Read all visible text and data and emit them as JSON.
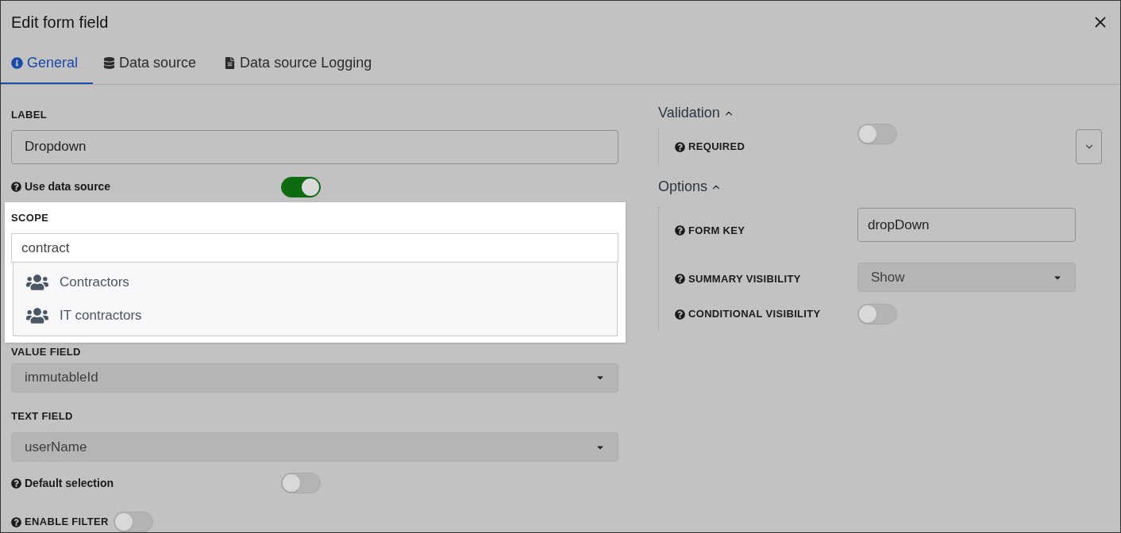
{
  "dialog": {
    "title": "Edit form field"
  },
  "tabs": [
    {
      "label": "General",
      "kind": "info",
      "selected": true
    },
    {
      "label": "Data source",
      "kind": "database",
      "selected": false
    },
    {
      "label": "Data source Logging",
      "kind": "file",
      "selected": false
    }
  ],
  "left": {
    "label_field": {
      "label": "LABEL",
      "value": "Dropdown"
    },
    "use_data_source": {
      "label": "Use data source",
      "on": true
    },
    "scope": {
      "label": "SCOPE",
      "value": "contract",
      "results": [
        {
          "label": "Contractors"
        },
        {
          "label": "IT contractors"
        }
      ]
    },
    "value_field": {
      "label": "VALUE FIELD",
      "value": "immutableId"
    },
    "text_field": {
      "label": "TEXT FIELD",
      "value": "userName"
    },
    "default_selection": {
      "label": "Default selection",
      "on": false
    },
    "enable_filter": {
      "label": "ENABLE FILTER",
      "on": false
    }
  },
  "right": {
    "validation": {
      "title": "Validation",
      "expanded": true,
      "required": {
        "label": "REQUIRED",
        "on": false
      }
    },
    "options": {
      "title": "Options",
      "expanded": true,
      "form_key": {
        "label": "FORM KEY",
        "value": "dropDown"
      },
      "summary_visibility": {
        "label": "SUMMARY VISIBILITY",
        "value": "Show"
      },
      "conditional_visibility": {
        "label": "CONDITIONAL VISIBILITY",
        "on": false
      }
    }
  }
}
